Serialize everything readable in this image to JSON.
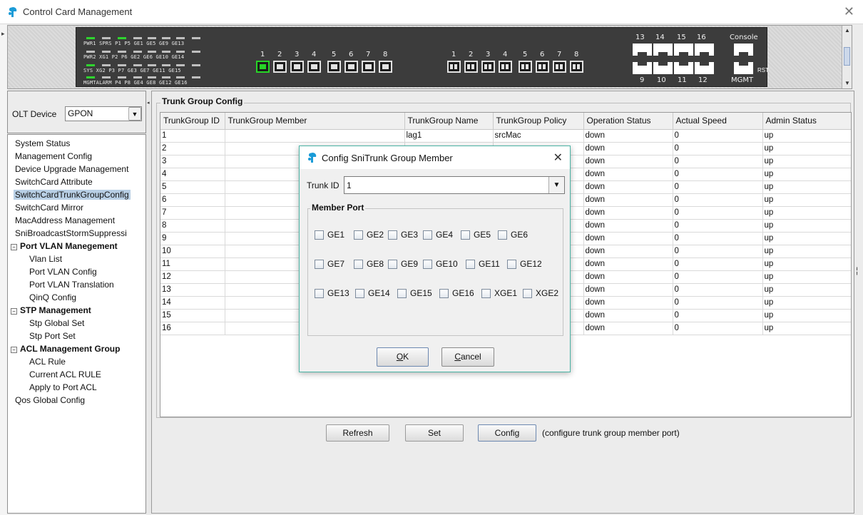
{
  "window": {
    "title": "Control Card Management",
    "close_glyph": "✕"
  },
  "device_panel": {
    "led_labels": {
      "row1": "PWR1 SPRS  P1   P5  GE1  GE5  GE9  GE13",
      "row2": "PWR2 XG1   P2   P6  GE2  GE6  GE10 GE14",
      "row3": "SYS  XG2   P3   P7  GE3  GE7  GE11 GE15",
      "row4": "MGMTALARM  P4   P8  GE4  GE8  GE12 GE16"
    },
    "sfp_group_a_numbers": [
      "1",
      "2",
      "3",
      "4",
      "5",
      "6",
      "7",
      "8"
    ],
    "sfp_group_b_numbers": [
      "1",
      "2",
      "3",
      "4",
      "5",
      "6",
      "7",
      "8"
    ],
    "rj45_top_numbers": [
      "13",
      "14",
      "15",
      "16"
    ],
    "rj45_bottom_numbers": [
      "9",
      "10",
      "11",
      "12"
    ],
    "console_label": "Console",
    "mgmt_label": "MGMT",
    "rst_label": "RST"
  },
  "olt": {
    "label": "OLT Device",
    "value": "GPON"
  },
  "nav": {
    "items": [
      {
        "label": "System Status"
      },
      {
        "label": "Management Config"
      },
      {
        "label": "Device Upgrade Management"
      },
      {
        "label": "SwitchCard Attribute"
      },
      {
        "label": "SwitchCardTrunkGroupConfig"
      },
      {
        "label": "SwitchCard Mirror"
      },
      {
        "label": "MacAddress Management"
      },
      {
        "label": "SniBroadcastStormSuppressi"
      },
      {
        "label": "Port VLAN Manegement"
      },
      {
        "label": "Vlan List"
      },
      {
        "label": "Port VLAN Config"
      },
      {
        "label": "Port VLAN Translation"
      },
      {
        "label": "QinQ Config"
      },
      {
        "label": "STP Management"
      },
      {
        "label": "Stp Global Set"
      },
      {
        "label": "Stp Port Set"
      },
      {
        "label": "ACL Management Group"
      },
      {
        "label": "ACL Rule"
      },
      {
        "label": "Current ACL RULE"
      },
      {
        "label": "Apply to Port ACL"
      },
      {
        "label": "Qos Global Config"
      }
    ]
  },
  "main": {
    "group_title": "Trunk Group Config",
    "columns": [
      "TrunkGroup ID",
      "TrunkGroup Member",
      "TrunkGroup Name",
      "TrunkGroup Policy",
      "Operation Status",
      "Actual Speed",
      "Admin Status"
    ],
    "rows": [
      [
        "1",
        "",
        "lag1",
        "srcMac",
        "down",
        "0",
        "up"
      ],
      [
        "2",
        "",
        "",
        "",
        "down",
        "0",
        "up"
      ],
      [
        "3",
        "",
        "",
        "",
        "down",
        "0",
        "up"
      ],
      [
        "4",
        "",
        "",
        "",
        "down",
        "0",
        "up"
      ],
      [
        "5",
        "",
        "",
        "",
        "down",
        "0",
        "up"
      ],
      [
        "6",
        "",
        "",
        "",
        "down",
        "0",
        "up"
      ],
      [
        "7",
        "",
        "",
        "",
        "down",
        "0",
        "up"
      ],
      [
        "8",
        "",
        "",
        "",
        "down",
        "0",
        "up"
      ],
      [
        "9",
        "",
        "",
        "",
        "down",
        "0",
        "up"
      ],
      [
        "10",
        "",
        "",
        "",
        "down",
        "0",
        "up"
      ],
      [
        "11",
        "",
        "",
        "",
        "down",
        "0",
        "up"
      ],
      [
        "12",
        "",
        "",
        "",
        "down",
        "0",
        "up"
      ],
      [
        "13",
        "",
        "",
        "",
        "down",
        "0",
        "up"
      ],
      [
        "14",
        "",
        "",
        "",
        "down",
        "0",
        "up"
      ],
      [
        "15",
        "",
        "",
        "",
        "down",
        "0",
        "up"
      ],
      [
        "16",
        "",
        "",
        "",
        "down",
        "0",
        "up"
      ]
    ],
    "buttons": {
      "refresh": "Refresh",
      "set": "Set",
      "config": "Config"
    },
    "hint": "(configure trunk group member port)"
  },
  "dialog": {
    "title": "Config SniTrunk Group Member",
    "close_glyph": "✕",
    "trunk_id_label": "Trunk ID",
    "trunk_id_value": "1",
    "member_port_title": "Member Port",
    "ports": [
      [
        "GE1",
        "GE2",
        "GE3",
        "GE4",
        "GE5",
        "GE6"
      ],
      [
        "GE7",
        "GE8",
        "GE9",
        "GE10",
        "GE11",
        "GE12"
      ],
      [
        "GE13",
        "GE14",
        "GE15",
        "GE16",
        "XGE1",
        "XGE2"
      ]
    ],
    "ok_mnemonic": "O",
    "ok_rest": "K",
    "cancel_mnemonic": "C",
    "cancel_rest": "ancel"
  },
  "colors": {
    "accent": "#4ab3a4",
    "selection": "#b8cfe5",
    "led_on": "#2fd42f",
    "logo": "#1a9bd7"
  }
}
